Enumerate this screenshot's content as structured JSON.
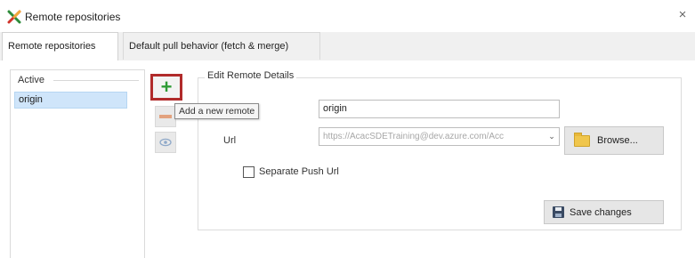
{
  "window": {
    "title": "Remote repositories",
    "close_glyph": "×"
  },
  "tabs": [
    {
      "label": "Remote repositories",
      "active": true
    },
    {
      "label": "Default pull behavior (fetch & merge)",
      "active": false
    }
  ],
  "remotes_list": {
    "label": "Active",
    "items": [
      "origin"
    ],
    "selected": "origin"
  },
  "actions": {
    "add_icon": "plus-icon",
    "remove_icon": "minus-icon",
    "view_icon": "eye-icon",
    "add_tooltip": "Add a new remote"
  },
  "edit_details": {
    "legend": "Edit Remote Details",
    "name_value": "origin",
    "url_label": "Url",
    "url_value": "https://AcacSDETraining@dev.azure.com/Acc",
    "browse_label": "Browse...",
    "separate_push_label": "Separate Push Url",
    "separate_push_checked": false,
    "save_label": "Save changes"
  },
  "colors": {
    "accent_red_outline": "#b12b2b",
    "add_green": "#2e9b35",
    "selection_blue": "#cfe5fa"
  }
}
